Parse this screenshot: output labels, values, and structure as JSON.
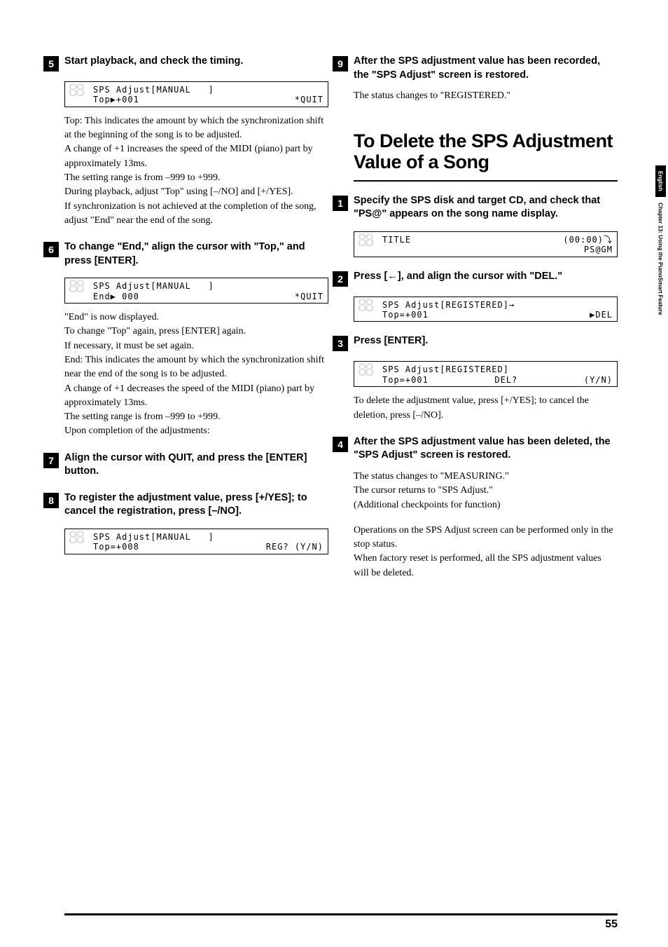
{
  "tab": {
    "lang": "English",
    "chapter": "Chapter 13: Using the PianoSmart Feature"
  },
  "left": {
    "s5": {
      "head": "Start playback, and check the timing.",
      "lcd1a": "SPS Adjust[MANUAL   ]",
      "lcd1b_left": "Top▶+001",
      "lcd1b_right": "*QUIT",
      "body": "Top: This indicates the amount by which the synchronization shift at the beginning of the song is to be adjusted.\nA change of +1 increases the speed of the MIDI (piano) part by approximately 13ms.\nThe setting range is from –999 to +999.\nDuring playback, adjust \"Top\" using [–/NO] and [+/YES].\nIf synchronization is not achieved at the completion of the song, adjust \"End\" near the end of the song."
    },
    "s6": {
      "head": "To change \"End,\" align the cursor with \"Top,\" and press [ENTER].",
      "lcd1a": "SPS Adjust[MANUAL   ]",
      "lcd1b_left": "End▶ 000",
      "lcd1b_right": "*QUIT",
      "body": "\"End\" is now displayed.\nTo change \"Top\" again, press [ENTER] again.\nIf necessary, it must be set again.\nEnd: This indicates the amount by which the synchronization shift near the end of the song is to be adjusted.\nA change of +1 decreases the speed of the MIDI (piano) part by approximately 13ms.\nThe setting range is from –999 to +999.\nUpon completion of the adjustments:"
    },
    "s7": {
      "head": "Align the cursor with QUIT, and press the [ENTER] button."
    },
    "s8": {
      "head": "To register the adjustment value, press [+/YES]; to cancel the registration, press [–/NO].",
      "lcd1a": "SPS Adjust[MANUAL   ]",
      "lcd1b_left": "Top=+008",
      "lcd1b_right": "REG? (Y/N)"
    }
  },
  "right": {
    "s9": {
      "head": "After the SPS adjustment value has been recorded, the \"SPS Adjust\" screen is restored.",
      "body": "The status changes to \"REGISTERED.\""
    },
    "section_title": "To Delete the SPS Adjustment Value of a Song",
    "d1": {
      "head": "Specify the SPS disk and target CD, and check that \"PS@\" appears on the song name display.",
      "lcd1a_left": "TITLE",
      "lcd1a_right": "(00:00)⤵",
      "lcd1b_right": "PS@GM"
    },
    "d2": {
      "head": "Press [←], and align the cursor with \"DEL.\"",
      "lcd1a": "SPS Adjust[REGISTERED]→",
      "lcd1b_left": "Top=+001",
      "lcd1b_right": "▶DEL"
    },
    "d3": {
      "head": "Press [ENTER].",
      "lcd1a": "SPS Adjust[REGISTERED]",
      "lcd1b_left": "Top=+001",
      "lcd1b_mid": "DEL?",
      "lcd1b_right": "(Y/N)",
      "body": "To delete the adjustment value, press [+/YES]; to cancel the deletion, press [–/NO]."
    },
    "d4": {
      "head": "After the SPS adjustment value has been deleted, the \"SPS Adjust\" screen is restored.",
      "body1": "The status changes to \"MEASURING.\"\nThe cursor returns to \"SPS Adjust.\"\n(Additional checkpoints for function)",
      "body2": "Operations on the SPS Adjust screen can be performed only in the stop status.\nWhen factory reset is performed, all the SPS adjustment values will be deleted."
    }
  },
  "page_number": "55"
}
